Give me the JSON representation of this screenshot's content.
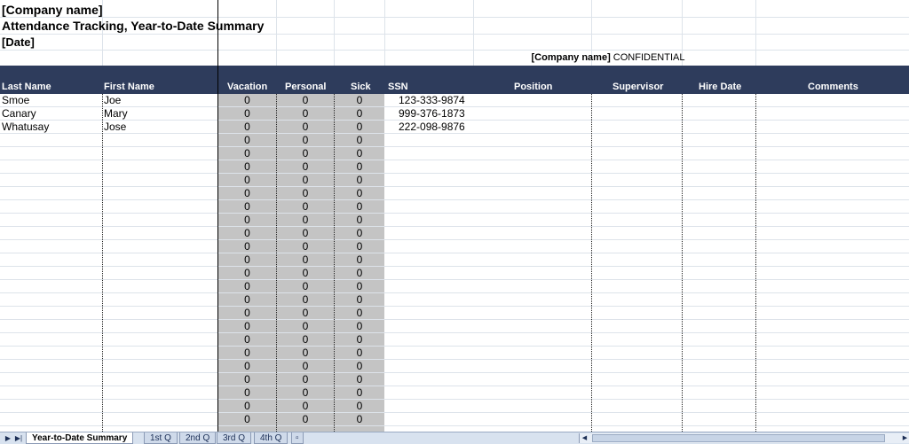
{
  "header": {
    "company_name": "[Company name]",
    "title": "Attendance Tracking, Year-to-Date Summary",
    "date": "[Date]",
    "confidential_company": "[Company name]",
    "confidential_label": " CONFIDENTIAL"
  },
  "columns": {
    "last_name": "Last Name",
    "first_name": "First Name",
    "vacation": "Vacation",
    "personal": "Personal",
    "sick": "Sick",
    "ssn": "SSN",
    "position": "Position",
    "supervisor": "Supervisor",
    "hire_date": "Hire Date",
    "comments": "Comments"
  },
  "rows": [
    {
      "last": "Smoe",
      "first": "Joe",
      "vacation": "0",
      "personal": "0",
      "sick": "0",
      "ssn": "123-333-9874"
    },
    {
      "last": "Canary",
      "first": "Mary",
      "vacation": "0",
      "personal": "0",
      "sick": "0",
      "ssn": "999-376-1873"
    },
    {
      "last": "Whatusay",
      "first": "Jose",
      "vacation": "0",
      "personal": "0",
      "sick": "0",
      "ssn": "222-098-9876"
    }
  ],
  "zero_value": "0",
  "empty_row_count": 22,
  "tabs": [
    "Year-to-Date Summary",
    "1st Q",
    "2nd Q",
    "3rd Q",
    "4th Q"
  ],
  "active_tab": "Year-to-Date Summary",
  "icons": {
    "nav_next": "next-sheet-icon",
    "nav_last": "last-sheet-icon",
    "insert_sheet": "insert-sheet-icon"
  },
  "colors": {
    "header_bar": "#2e3c5c",
    "gray_band": "#c4c4c4"
  }
}
